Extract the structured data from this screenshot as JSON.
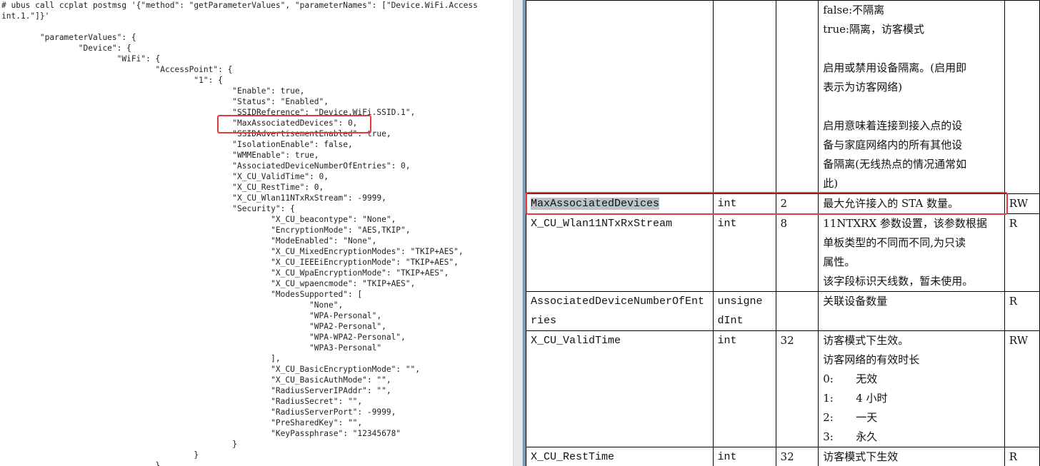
{
  "terminal": {
    "lines": [
      "# ubus call ccplat postmsg '{\"method\": \"getParameterValues\", \"parameterNames\": [\"Device.WiFi.Access",
      "int.1.\"]}'",
      "",
      "        \"parameterValues\": {",
      "                \"Device\": {",
      "                        \"WiFi\": {",
      "                                \"AccessPoint\": {",
      "                                        \"1\": {",
      "                                                \"Enable\": true,",
      "                                                \"Status\": \"Enabled\",",
      "                                                \"SSIDReference\": \"Device.WiFi.SSID.1\",",
      "                                                \"MaxAssociatedDevices\": 0,",
      "                                                \"SSIDAdvertisementEnabled\": true,",
      "                                                \"IsolationEnable\": false,",
      "                                                \"WMMEnable\": true,",
      "                                                \"AssociatedDeviceNumberOfEntries\": 0,",
      "                                                \"X_CU_ValidTime\": 0,",
      "                                                \"X_CU_RestTime\": 0,",
      "                                                \"X_CU_Wlan11NTxRxStream\": -9999,",
      "                                                \"Security\": {",
      "                                                        \"X_CU_beacontype\": \"None\",",
      "                                                        \"EncryptionMode\": \"AES,TKIP\",",
      "                                                        \"ModeEnabled\": \"None\",",
      "                                                        \"X_CU_MixedEncryptionModes\": \"TKIP+AES\",",
      "                                                        \"X_CU_IEEEiEncryptionMode\": \"TKIP+AES\",",
      "                                                        \"X_CU_WpaEncryptionMode\": \"TKIP+AES\",",
      "                                                        \"X_CU_wpaencmode\": \"TKIP+AES\",",
      "                                                        \"ModesSupported\": [",
      "                                                                \"None\",",
      "                                                                \"WPA-Personal\",",
      "                                                                \"WPA2-Personal\",",
      "                                                                \"WPA-WPA2-Personal\",",
      "                                                                \"WPA3-Personal\"",
      "                                                        ],",
      "                                                        \"X_CU_BasicEncryptionMode\": \"\",",
      "                                                        \"X_CU_BasicAuthMode\": \"\",",
      "                                                        \"RadiusServerIPAddr\": \"\",",
      "                                                        \"RadiusSecret\": \"\",",
      "                                                        \"RadiusServerPort\": -9999,",
      "                                                        \"PreSharedKey\": \"\",",
      "                                                        \"KeyPassphrase\": \"12345678\"",
      "                                                }",
      "                                        }",
      "                                }"
    ]
  },
  "doc_table": {
    "rows": [
      {
        "name": "",
        "type": "",
        "value": "",
        "desc_lines": [
          "false:不隔离",
          "true:隔离，访客模式",
          "",
          "启用或禁用设备隔离。(启用即",
          "表示为访客网络)",
          "",
          "启用意味着连接到接入点的设",
          "备与家庭网络内的所有其他设",
          "备隔离(无线热点的情况通常如",
          "此)"
        ],
        "access": ""
      },
      {
        "name": "MaxAssociatedDevices",
        "type": "int",
        "value": "2",
        "desc_lines": [
          "最大允许接入的 STA 数量。"
        ],
        "access": "RW"
      },
      {
        "name": "X_CU_Wlan11NTxRxStream",
        "type": "int",
        "value": "8",
        "desc_lines": [
          "11NTXRX 参数设置，该参数根据",
          "单板类型的不同而不同,为只读",
          "属性。",
          "该字段标识天线数，暂未使用。"
        ],
        "access": "R"
      },
      {
        "name_lines": [
          "AssociatedDeviceNumberOfEnt",
          "ries"
        ],
        "type_lines": [
          "unsigne",
          "dInt"
        ],
        "value": "",
        "desc_lines": [
          "关联设备数量"
        ],
        "access": "R"
      },
      {
        "name": "X_CU_ValidTime",
        "type": "int",
        "value": "32",
        "desc_lines": [
          "访客模式下生效。",
          "访客网络的有效时长"
        ],
        "options": [
          {
            "code": "0:",
            "label": "无效"
          },
          {
            "code": "1:",
            "label": "4 小时"
          },
          {
            "code": "2:",
            "label": "一天"
          },
          {
            "code": "3:",
            "label": "永久"
          }
        ],
        "access": "RW"
      },
      {
        "name": "X_CU_RestTime",
        "type": "int",
        "value": "32",
        "desc_lines": [
          "访客模式下生效"
        ],
        "access": "R"
      }
    ]
  },
  "colors": {
    "highlight_box": "#e23c3c",
    "selection": "#b9c3c8",
    "doc_edge": "#7e9ab8"
  }
}
